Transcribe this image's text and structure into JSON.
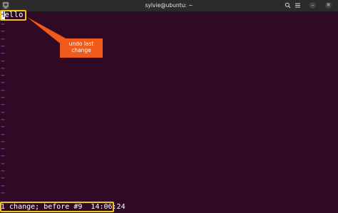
{
  "window": {
    "title": "sylvie@ubuntu: ~",
    "search_icon": "search-icon",
    "menu_icon": "hamburger-icon",
    "minimize_icon": "minimize-icon",
    "close_icon": "close-icon",
    "minimize_glyph": "–",
    "close_glyph": "✕",
    "background_color": "#300a24"
  },
  "editor": {
    "cursor_char": "H",
    "line_rest": "ello",
    "tilde": "~",
    "tilde_count": 24,
    "tilde_color": "#6e6ad1"
  },
  "annotation": {
    "callout_text": "undo last change",
    "callout_color": "#f05a1a",
    "highlight_color": "#f0c419"
  },
  "status": {
    "message": "1 change; before #9  14:06:24"
  }
}
